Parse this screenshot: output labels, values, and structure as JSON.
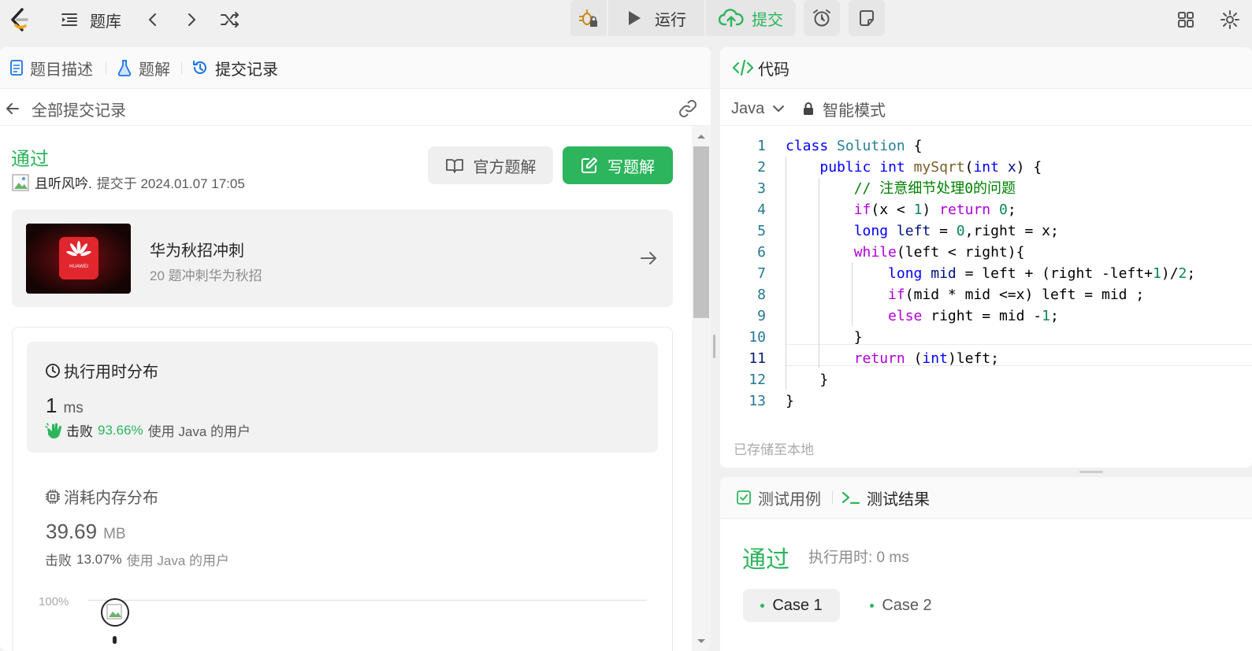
{
  "topbar": {
    "problems_label": "题库",
    "run_label": "运行",
    "submit_label": "提交"
  },
  "left_tabs": {
    "description": "题目描述",
    "solutions": "题解",
    "submissions": "提交记录"
  },
  "submission_header": {
    "back_label": "全部提交记录"
  },
  "result": {
    "status": "通过",
    "user": "且听风吟.",
    "submitted_at": "提交于 2024.01.07 17:05",
    "official_solution_label": "官方题解",
    "write_solution_label": "写题解"
  },
  "promo": {
    "title": "华为秋招冲刺",
    "subtitle": "20 题冲刺华为秋招",
    "logo_text": "HUAWEI"
  },
  "runtime": {
    "title": "执行用时分布",
    "value": "1",
    "unit": "ms",
    "beat_prefix": "击败",
    "beat_percent": "93.66%",
    "beat_suffix": "使用 Java 的用户"
  },
  "memory": {
    "title": "消耗内存分布",
    "value": "39.69",
    "unit": "MB",
    "beat_prefix": "击败",
    "beat_percent": "13.07%",
    "beat_suffix": "使用 Java 的用户"
  },
  "chart": {
    "y_label_top": "100%"
  },
  "code_panel": {
    "title": "代码",
    "language": "Java",
    "mode": "智能模式",
    "saved_hint": "已存储至本地",
    "line_numbers": [
      "1",
      "2",
      "3",
      "4",
      "5",
      "6",
      "7",
      "8",
      "9",
      "10",
      "11",
      "12",
      "13"
    ],
    "active_line": 11
  },
  "test_panel": {
    "tab_cases": "测试用例",
    "tab_results": "测试结果",
    "status": "通过",
    "runtime_text": "执行用时: 0 ms",
    "case1": "Case 1",
    "case2": "Case 2"
  },
  "colors": {
    "accent_green": "#2db55d",
    "tab_blue": "#1a73e8",
    "code_keyword": "#0000ff",
    "code_control": "#af00db",
    "code_comment": "#008000"
  }
}
